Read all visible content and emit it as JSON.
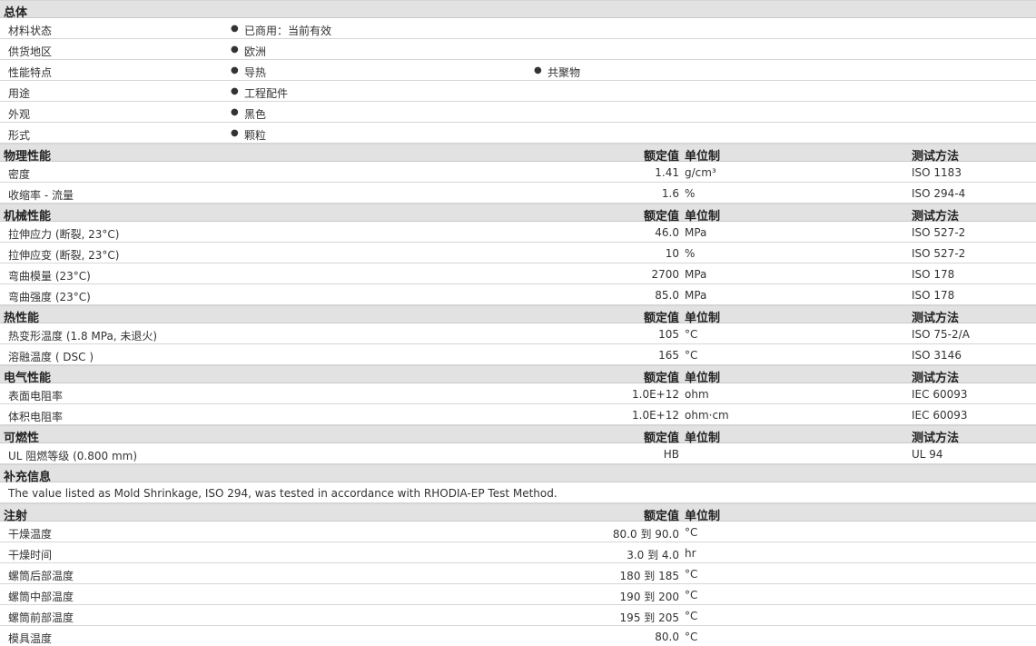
{
  "general": {
    "title": "总体",
    "rows": [
      {
        "label": "材料状态",
        "values": [
          "已商用：当前有效"
        ]
      },
      {
        "label": "供货地区",
        "values": [
          "欧洲"
        ]
      },
      {
        "label": "性能特点",
        "values": [
          "导热",
          "共聚物"
        ]
      },
      {
        "label": "用途",
        "values": [
          "工程配件"
        ]
      },
      {
        "label": "外观",
        "values": [
          "黑色"
        ]
      },
      {
        "label": "形式",
        "values": [
          "颗粒"
        ]
      }
    ]
  },
  "column_headers": {
    "value": "额定值",
    "unit": "单位制",
    "method": "测试方法"
  },
  "physical": {
    "title": "物理性能",
    "rows": [
      {
        "label": "密度",
        "value": "1.41",
        "unit": "g/cm³",
        "method": "ISO 1183"
      },
      {
        "label": "收缩率 - 流量",
        "value": "1.6",
        "unit": "%",
        "method": "ISO 294-4"
      }
    ]
  },
  "mechanical": {
    "title": "机械性能",
    "rows": [
      {
        "label": "拉伸应力 (断裂, 23°C)",
        "value": "46.0",
        "unit": "MPa",
        "method": "ISO 527-2"
      },
      {
        "label": "拉伸应变 (断裂, 23°C)",
        "value": "10",
        "unit": "%",
        "method": "ISO 527-2"
      },
      {
        "label": "弯曲模量 (23°C)",
        "value": "2700",
        "unit": "MPa",
        "method": "ISO 178"
      },
      {
        "label": "弯曲强度 (23°C)",
        "value": "85.0",
        "unit": "MPa",
        "method": "ISO 178"
      }
    ]
  },
  "thermal": {
    "title": "热性能",
    "rows": [
      {
        "label": "热变形温度 (1.8 MPa, 未退火)",
        "value": "105",
        "unit": "°C",
        "method": "ISO 75-2/A"
      },
      {
        "label": "溶融温度 ( DSC )",
        "value": "165",
        "unit": "°C",
        "method": "ISO 3146"
      }
    ]
  },
  "electrical": {
    "title": "电气性能",
    "rows": [
      {
        "label": "表面电阻率",
        "value": "1.0E+12",
        "unit": "ohm",
        "method": "IEC 60093"
      },
      {
        "label": "体积电阻率",
        "value": "1.0E+12",
        "unit": "ohm·cm",
        "method": "IEC 60093"
      }
    ]
  },
  "flammability": {
    "title": "可燃性",
    "rows": [
      {
        "label": "UL 阻燃等级 (0.800 mm)",
        "value": "HB",
        "unit": "",
        "method": "UL 94"
      }
    ]
  },
  "supplementary": {
    "title": "补充信息",
    "note": "The value listed as Mold Shrinkage, ISO 294, was tested in accordance with RHODIA-EP Test Method."
  },
  "injection": {
    "title": "注射",
    "rows": [
      {
        "label": "干燥温度",
        "value": "80.0 到  90.0",
        "unit": "°C"
      },
      {
        "label": "干燥时间",
        "value": "3.0 到  4.0",
        "unit": "hr"
      },
      {
        "label": "螺筒后部温度",
        "value": "180 到  185",
        "unit": "°C"
      },
      {
        "label": "螺筒中部温度",
        "value": "190 到  200",
        "unit": "°C"
      },
      {
        "label": "螺筒前部温度",
        "value": "195 到  205",
        "unit": "°C"
      },
      {
        "label": "模具温度",
        "value": "80.0",
        "unit": "°C"
      }
    ]
  },
  "bullet": "●"
}
